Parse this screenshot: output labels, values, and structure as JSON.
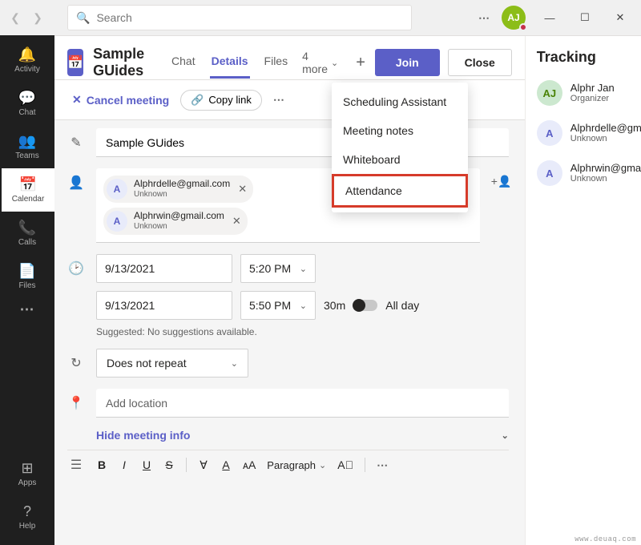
{
  "search": {
    "placeholder": "Search"
  },
  "user": {
    "initials": "AJ"
  },
  "rail": {
    "items": [
      {
        "icon": "🔔",
        "label": "Activity"
      },
      {
        "icon": "💬",
        "label": "Chat"
      },
      {
        "icon": "👥",
        "label": "Teams"
      },
      {
        "icon": "📅",
        "label": "Calendar"
      },
      {
        "icon": "📞",
        "label": "Calls"
      },
      {
        "icon": "📄",
        "label": "Files"
      }
    ],
    "apps": {
      "icon": "⊞",
      "label": "Apps"
    },
    "help": {
      "icon": "?",
      "label": "Help"
    }
  },
  "header": {
    "title": "Sample GUides",
    "tabs": [
      "Chat",
      "Details",
      "Files"
    ],
    "more_label": "4 more",
    "join": "Join",
    "close": "Close"
  },
  "actionbar": {
    "cancel": "Cancel meeting",
    "copy": "Copy link"
  },
  "menu": {
    "items": [
      "Scheduling Assistant",
      "Meeting notes",
      "Whiteboard",
      "Attendance"
    ]
  },
  "form": {
    "title_value": "Sample GUides",
    "attendees": [
      {
        "initial": "A",
        "email": "Alphrdelle@gmail.com",
        "status": "Unknown"
      },
      {
        "initial": "A",
        "email": "Alphrwin@gmail.com",
        "status": "Unknown"
      }
    ],
    "start_date": "9/13/2021",
    "start_time": "5:20 PM",
    "end_date": "9/13/2021",
    "end_time": "5:50 PM",
    "duration": "30m",
    "all_day": "All day",
    "suggested": "Suggested: No suggestions available.",
    "recurrence": "Does not repeat",
    "location_placeholder": "Add location",
    "hide_info": "Hide meeting info",
    "rte": {
      "paragraph": "Paragraph"
    }
  },
  "tracking": {
    "title": "Tracking",
    "people": [
      {
        "initials": "AJ",
        "name": "Alphr Jan",
        "role": "Organizer",
        "cls": "ta-green"
      },
      {
        "initials": "A",
        "name": "Alphrdelle@gmail.com",
        "role": "Unknown",
        "cls": "ta-purple"
      },
      {
        "initials": "A",
        "name": "Alphrwin@gmail.com",
        "role": "Unknown",
        "cls": "ta-purple"
      }
    ]
  },
  "watermark": "www.deuaq.com"
}
